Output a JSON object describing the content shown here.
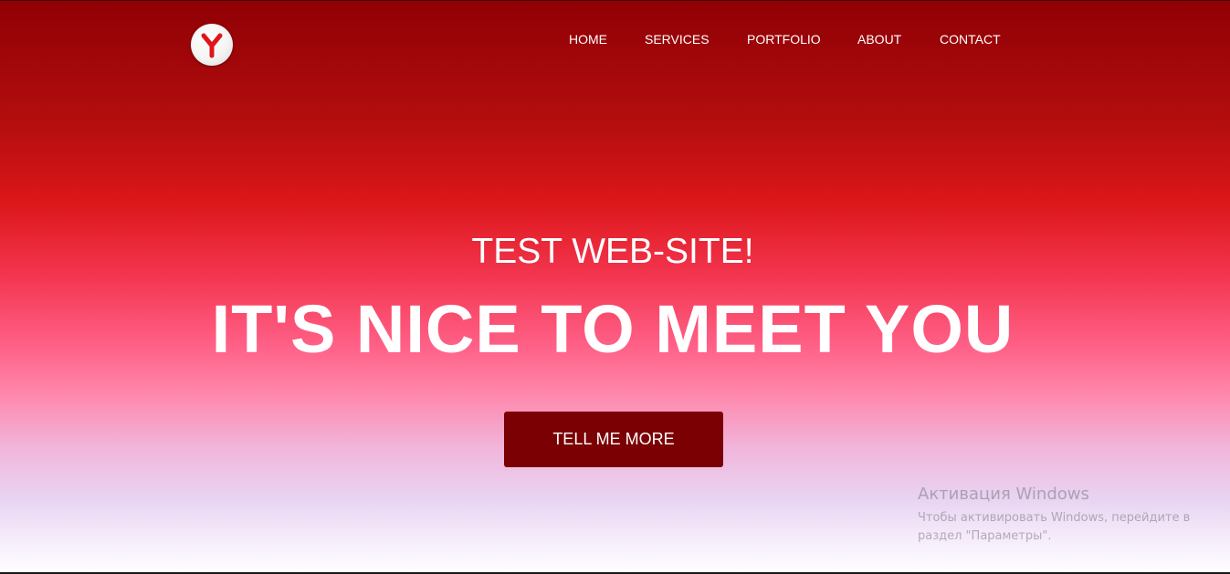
{
  "header": {
    "logo_icon": "yandex-browser-logo-icon",
    "nav": [
      {
        "label": "HOME"
      },
      {
        "label": "SERVICES"
      },
      {
        "label": "PORTFOLIO"
      },
      {
        "label": "ABOUT"
      },
      {
        "label": "CONTACT"
      }
    ]
  },
  "hero": {
    "subtitle": "TEST WEB-SITE!",
    "headline": "IT'S NICE TO MEET YOU",
    "cta_label": "TELL ME MORE"
  },
  "watermark": {
    "title": "Активация Windows",
    "line1": "Чтобы активировать Windows, перейдите в",
    "line2": "раздел \"Параметры\"."
  },
  "colors": {
    "gradient_top": "#8f0004",
    "gradient_mid": "#dc1619",
    "gradient_pink": "#ff5f86",
    "gradient_bottom": "#ffffff",
    "cta_background": "#7a0004",
    "text": "#ffffff"
  }
}
